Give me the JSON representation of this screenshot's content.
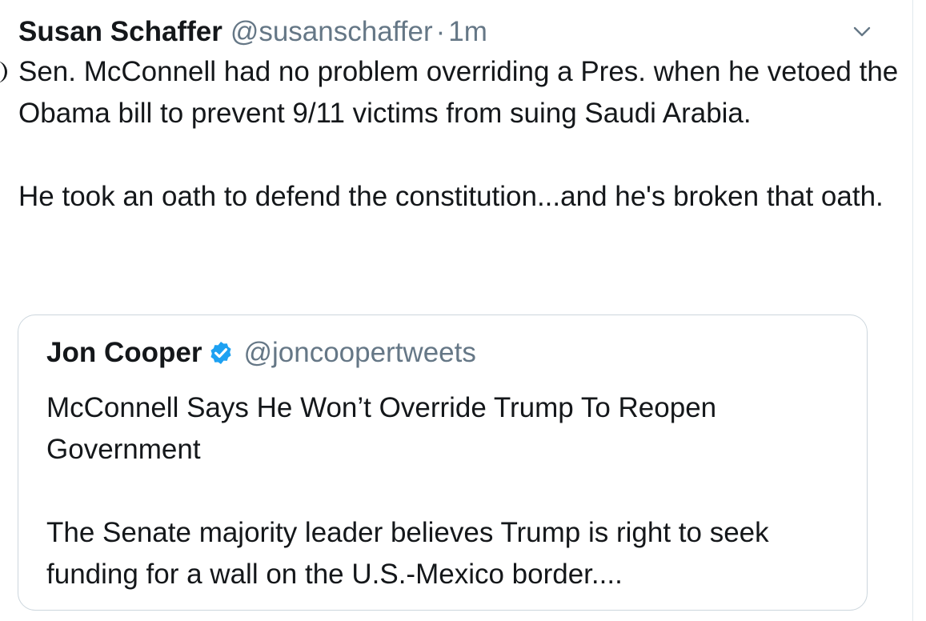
{
  "tweet": {
    "author_name": "Susan Schaffer",
    "author_handle": "@susanschaffer",
    "separator": "·",
    "timestamp": "1m",
    "more_icon": "chevron-down-icon",
    "paragraphs": [
      "Sen. McConnell had no problem overriding a Pres. when he vetoed the Obama bill to prevent 9/11 victims from suing Saudi Arabia.",
      "He took an oath to defend the constitution...and he's broken that oath."
    ]
  },
  "quoted_tweet": {
    "author_name": "Jon Cooper",
    "verified_icon": "verified-badge-icon",
    "author_handle": "@joncoopertweets",
    "paragraphs": [
      "McConnell Says He Won’t Override Trump To Reopen Government",
      "The Senate majority leader believes Trump is right to seek funding for a wall on the U.S.-Mexico border...."
    ]
  },
  "colors": {
    "text": "#14171a",
    "secondary_text": "#657786",
    "verified": "#1da1f2",
    "border": "#ccd6dd"
  }
}
